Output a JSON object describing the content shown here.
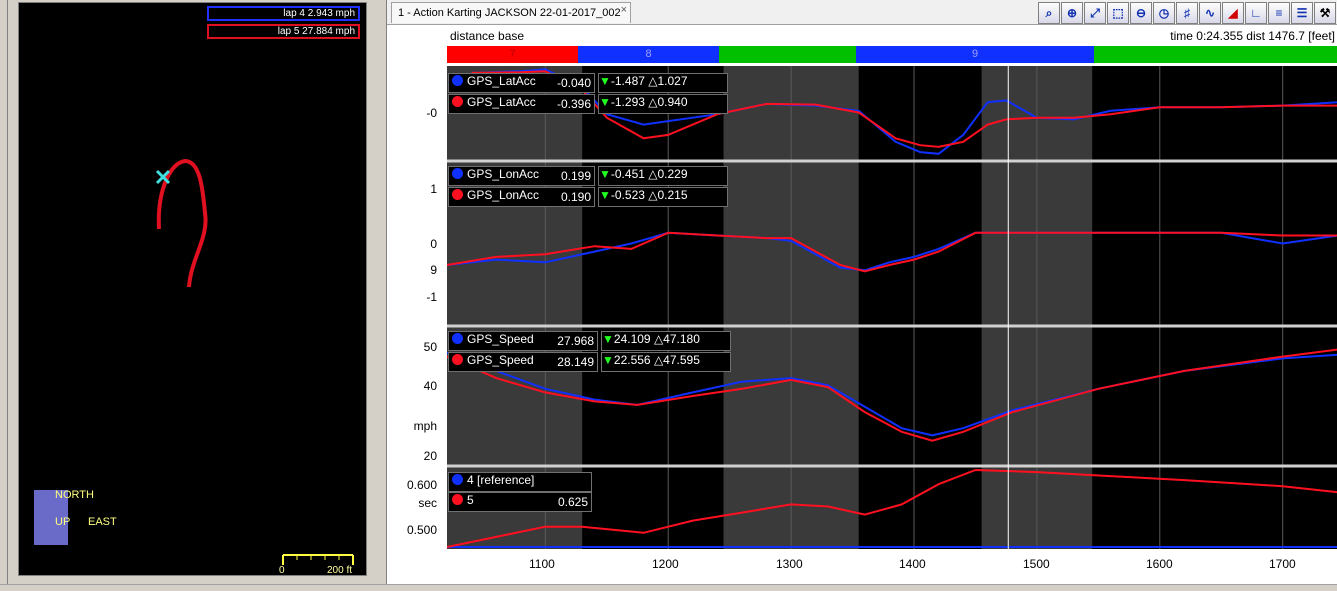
{
  "map": {
    "laps": [
      {
        "label": "lap 4 2.943 mph",
        "color": "#2030ff"
      },
      {
        "label": "lap 5 27.884 mph",
        "color": "#e01020"
      }
    ],
    "compass": {
      "north": "NORTH",
      "up": "UP",
      "east": "EAST"
    },
    "scale": {
      "start": "0",
      "end": "200 ft"
    }
  },
  "tab": {
    "title": "1 - Action Karting JACKSON 22-01-2017_002",
    "close": "×"
  },
  "toolbar": [
    "zoom-2d",
    "zoom-in",
    "zoom-fit",
    "zoom-select",
    "zoom-out",
    "clock",
    "grid",
    "overlay",
    "triangle",
    "layout-l",
    "layout-e",
    "layout-list",
    "wrench"
  ],
  "header": {
    "base": "distance base",
    "time": "time 0:24.355",
    "dist": "dist 1476.7 [feet]"
  },
  "segments": [
    {
      "label": "7",
      "color": "#ff0000",
      "text_color": "#b00000"
    },
    {
      "label": "8",
      "color": "#1030ff",
      "text_color": "#a0a0ff"
    },
    {
      "label": "",
      "color": "#00c000",
      "text_color": "#00c000"
    },
    {
      "label": "9",
      "color": "#1030ff",
      "text_color": "#a0a0ff"
    },
    {
      "label": "",
      "color": "#00c000",
      "text_color": "#00c000"
    }
  ],
  "panels": [
    {
      "rows": [
        {
          "channel": "GPS_LatAcc",
          "value": "-0.040",
          "min": "-1.487",
          "max": "1.027",
          "color": "blue"
        },
        {
          "channel": "GPS_LatAcc",
          "value": "-0.396",
          "min": "-1.293",
          "max": "0.940",
          "color": "red"
        }
      ],
      "y_ticks": [
        "-0"
      ]
    },
    {
      "rows": [
        {
          "channel": "GPS_LonAcc",
          "value": "0.199",
          "min": "-0.451",
          "max": "0.229",
          "color": "blue"
        },
        {
          "channel": "GPS_LonAcc",
          "value": "0.190",
          "min": "-0.523",
          "max": "0.215",
          "color": "red"
        }
      ],
      "y_ticks": [
        "1",
        "0",
        "9",
        "-1"
      ]
    },
    {
      "rows": [
        {
          "channel": "GPS_Speed",
          "value": "27.968",
          "min": "24.109",
          "max": "47.180",
          "color": "blue"
        },
        {
          "channel": "GPS_Speed",
          "value": "28.149",
          "min": "22.556",
          "max": "47.595",
          "color": "red"
        }
      ],
      "y_ticks": [
        "50",
        "40",
        "mph",
        "20"
      ]
    },
    {
      "rows": [
        {
          "channel": "4 [reference]",
          "value": "",
          "color": "blue"
        },
        {
          "channel": "5",
          "value": "0.625",
          "color": "red"
        }
      ],
      "y_ticks": [
        "0.600",
        "sec",
        "0.500"
      ]
    }
  ],
  "x_ticks": [
    "1100",
    "1200",
    "1300",
    "1400",
    "1500",
    "1600",
    "1700"
  ],
  "chart_data": [
    {
      "type": "line",
      "x_range": [
        1020,
        1745
      ],
      "sector_shading": [
        [
          1020,
          1130
        ],
        [
          1245,
          1355
        ],
        [
          1455,
          1545
        ]
      ],
      "series": [
        {
          "color": "#1030ff",
          "x": [
            1040,
            1080,
            1100,
            1130,
            1150,
            1180,
            1200,
            1240,
            1280,
            1320,
            1355,
            1385,
            1405,
            1420,
            1440,
            1460,
            1475,
            1500,
            1530,
            1560,
            1600,
            1650,
            1700,
            1745
          ],
          "y": [
            0.9,
            0.95,
            1.0,
            0.5,
            -0.3,
            -0.6,
            -0.5,
            -0.3,
            0.0,
            -0.05,
            -0.2,
            -1.1,
            -1.4,
            -1.45,
            -0.9,
            0.05,
            0.1,
            -0.4,
            -0.45,
            -0.2,
            -0.1,
            -0.1,
            -0.05,
            0.05
          ]
        },
        {
          "color": "#ff1020",
          "x": [
            1040,
            1080,
            1100,
            1130,
            1150,
            1180,
            1200,
            1240,
            1280,
            1320,
            1355,
            1385,
            1405,
            1420,
            1440,
            1460,
            1475,
            1500,
            1530,
            1560,
            1600,
            1650,
            1700,
            1745
          ],
          "y": [
            0.9,
            0.92,
            0.95,
            0.4,
            -0.4,
            -1.0,
            -0.9,
            -0.3,
            0.0,
            -0.02,
            -0.25,
            -1.0,
            -1.2,
            -1.25,
            -1.1,
            -0.6,
            -0.45,
            -0.4,
            -0.4,
            -0.3,
            -0.1,
            -0.1,
            -0.05,
            -0.05
          ]
        }
      ],
      "ylim": [
        -1.6,
        1.1
      ]
    },
    {
      "type": "line",
      "x_range": [
        1020,
        1745
      ],
      "series": [
        {
          "color": "#1030ff",
          "x": [
            1020,
            1060,
            1100,
            1140,
            1170,
            1200,
            1240,
            1280,
            1300,
            1340,
            1360,
            1380,
            1400,
            1420,
            1450,
            1500,
            1560,
            1600,
            1650,
            1700,
            1745
          ],
          "y": [
            -0.4,
            -0.3,
            -0.35,
            -0.15,
            0.0,
            0.2,
            0.15,
            0.1,
            0.05,
            -0.45,
            -0.5,
            -0.35,
            -0.25,
            -0.1,
            0.2,
            0.2,
            0.2,
            0.2,
            0.2,
            0.0,
            0.15
          ]
        },
        {
          "color": "#ff1020",
          "x": [
            1020,
            1060,
            1100,
            1140,
            1170,
            1200,
            1240,
            1280,
            1300,
            1340,
            1360,
            1380,
            1400,
            1420,
            1450,
            1500,
            1560,
            1600,
            1650,
            1700,
            1745
          ],
          "y": [
            -0.4,
            -0.25,
            -0.2,
            -0.05,
            -0.1,
            0.2,
            0.15,
            0.1,
            0.1,
            -0.4,
            -0.52,
            -0.4,
            -0.3,
            -0.15,
            0.2,
            0.2,
            0.2,
            0.2,
            0.2,
            0.15,
            0.15
          ]
        }
      ],
      "ylim": [
        -1.5,
        1.5
      ]
    },
    {
      "type": "line",
      "x_range": [
        1020,
        1745
      ],
      "series": [
        {
          "color": "#1030ff",
          "x": [
            1020,
            1060,
            1100,
            1140,
            1175,
            1220,
            1260,
            1300,
            1330,
            1360,
            1390,
            1415,
            1440,
            1480,
            1550,
            1620,
            1700,
            1745
          ],
          "y": [
            47,
            42,
            37,
            34,
            32.5,
            36,
            39,
            40,
            38,
            32,
            26,
            24,
            26,
            31,
            37,
            42,
            45.5,
            46.5
          ]
        },
        {
          "color": "#ff1020",
          "x": [
            1020,
            1060,
            1100,
            1140,
            1175,
            1220,
            1260,
            1300,
            1330,
            1360,
            1390,
            1415,
            1440,
            1480,
            1550,
            1620,
            1700,
            1745
          ],
          "y": [
            46,
            40,
            36,
            33.5,
            32.5,
            35,
            37,
            39.5,
            37.5,
            30.5,
            25,
            22.5,
            25,
            30.5,
            37,
            42,
            46,
            48
          ]
        }
      ],
      "ylim": [
        16,
        54
      ]
    },
    {
      "type": "line",
      "x_range": [
        1020,
        1745
      ],
      "series": [
        {
          "color": "#1030ff",
          "x": [
            1020,
            1745
          ],
          "y": [
            0.455,
            0.455
          ]
        },
        {
          "color": "#ff1020",
          "x": [
            1020,
            1060,
            1100,
            1130,
            1180,
            1220,
            1260,
            1300,
            1330,
            1360,
            1390,
            1420,
            1450,
            1500,
            1560,
            1620,
            1700,
            1745
          ],
          "y": [
            0.455,
            0.48,
            0.505,
            0.505,
            0.49,
            0.52,
            0.54,
            0.56,
            0.555,
            0.535,
            0.56,
            0.61,
            0.645,
            0.64,
            0.63,
            0.62,
            0.605,
            0.59
          ]
        }
      ],
      "ylim": [
        0.45,
        0.65
      ]
    }
  ]
}
